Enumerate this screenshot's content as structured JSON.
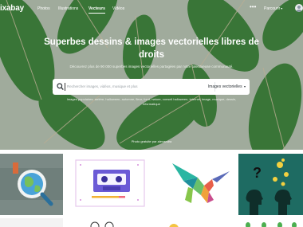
{
  "brand": {
    "logo": "ixabay"
  },
  "nav": {
    "items": [
      "Photos",
      "Illustrations",
      "Vecteurs",
      "Vidéos"
    ],
    "active": "Vecteurs"
  },
  "header": {
    "more": "•••",
    "browse": "Parcourir"
  },
  "hero": {
    "title": "Superbes dessins & images vectorielles libres de droits",
    "subtitle": "Découvrez plus de 90 000 superbes images vectorielles partagées par notre talentueuse communauté.",
    "search_placeholder": "Rechercher images, vidéos, musique et plus",
    "search_type": "Images vectorielles",
    "popular": "Images populaires: arrière, halloween, automne, fleur, fond, nature, conseil halloween, internet, image, musique, dessin, informatique",
    "credit": "Photo gratuite par alexandra"
  },
  "tiles": [
    {
      "name": "globe-magnifier",
      "bg": "#7b8a86"
    },
    {
      "name": "cassette",
      "bg": "#ffffff"
    },
    {
      "name": "hummingbird",
      "bg": "#ffffff"
    },
    {
      "name": "heads-ideas",
      "bg": "#1e6b62"
    }
  ],
  "colors": {
    "hero_bg": "#aab6a6",
    "leaf": "#3a7a3a",
    "leaf_vein": "#c9b79b"
  }
}
